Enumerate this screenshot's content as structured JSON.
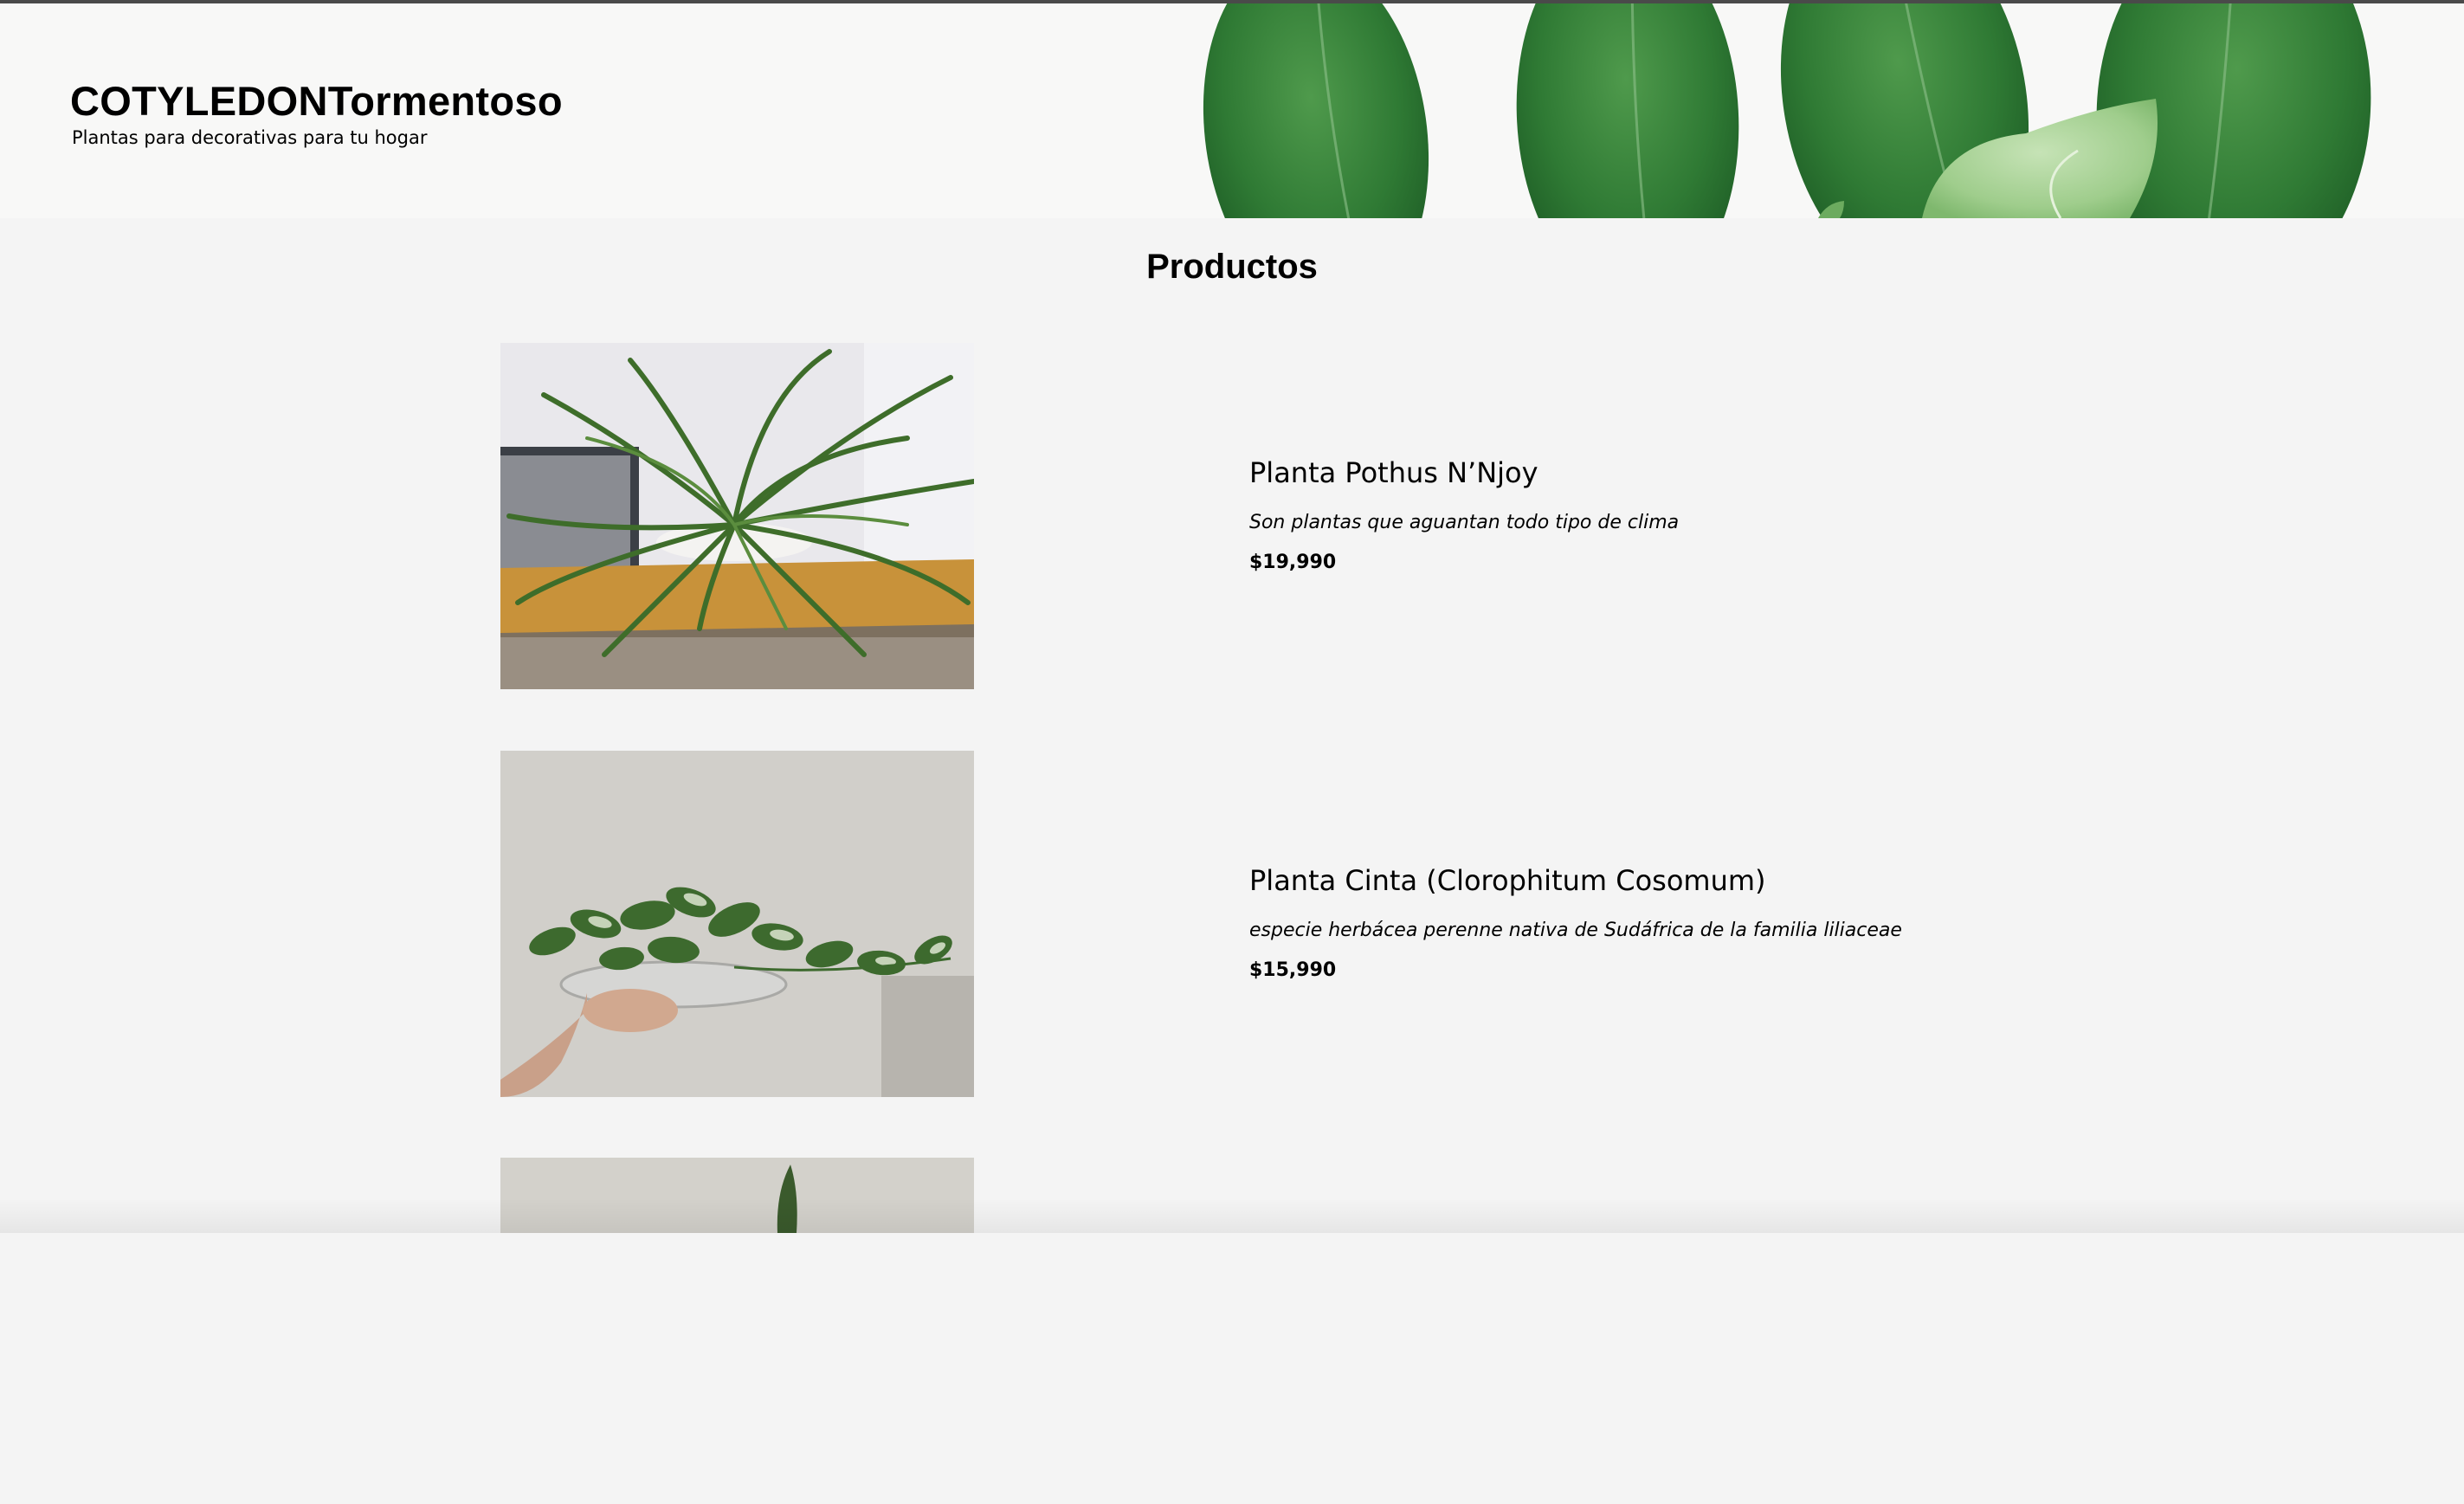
{
  "header": {
    "brand_title": "COTYLEDONTormentoso",
    "brand_subtitle": "Plantas para decorativas para tu hogar"
  },
  "main": {
    "section_title": "Productos",
    "products": [
      {
        "name": "Planta Pothus N’Njoy",
        "description": "Son plantas que aguantan todo tipo de clima",
        "price": "$19,990"
      },
      {
        "name": "Planta Cinta (Clorophitum Cosomum)",
        "description": "especie herbácea perenne nativa de Sudáfrica de la familia liliaceae",
        "price": "$15,990"
      }
    ]
  },
  "colors": {
    "page_background": "#f4f4f4",
    "header_background": "#f8f8f7",
    "leaf_green": "#2f7a36",
    "text": "#000000"
  }
}
